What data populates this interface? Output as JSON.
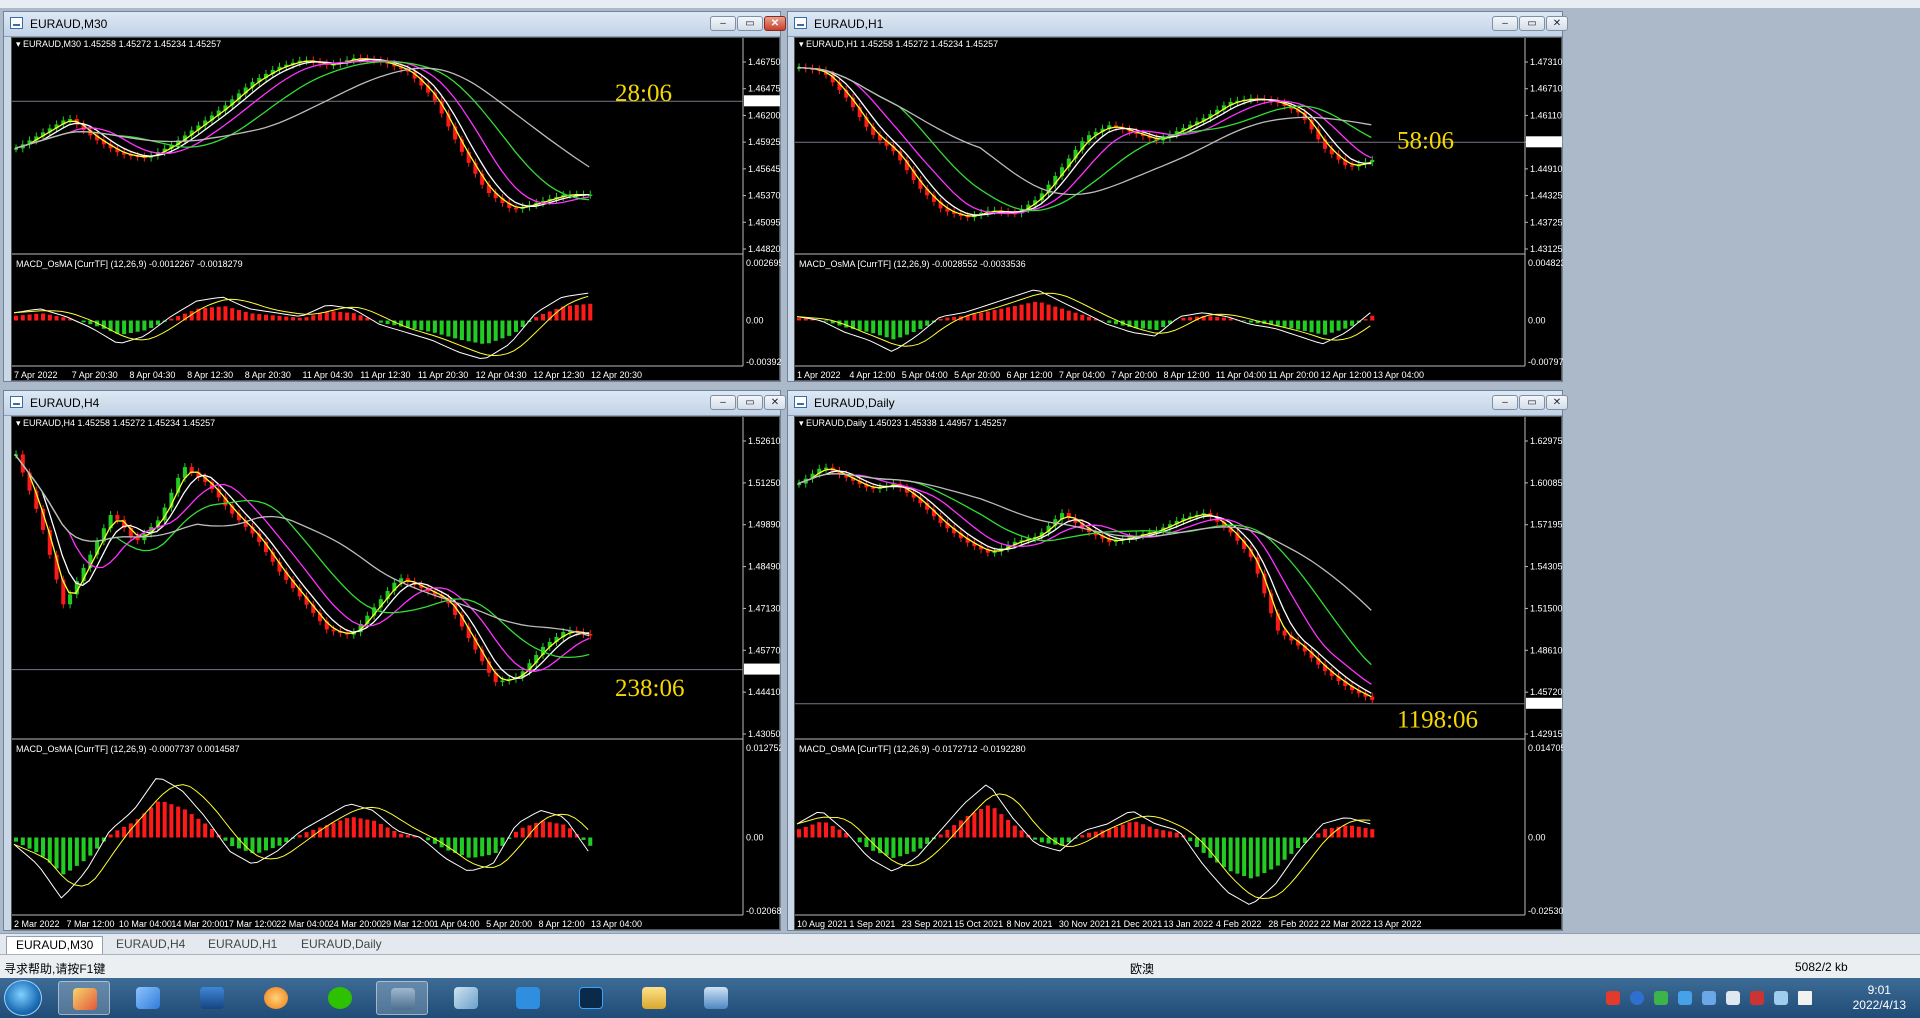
{
  "colors": {
    "bull": "#ff1a1a",
    "bear": "#22cc22",
    "timer": "#f5d800",
    "ma_fast": "#ffff33",
    "ma_white": "#ffffff",
    "ma_magenta": "#ff33ff",
    "ma_green": "#33dd33",
    "ma_gray": "#bbbbbb"
  },
  "windows": [
    {
      "title": "EURAUD,M30",
      "header": "EURAUD,M30  1.45258 1.45272 1.45234 1.45257",
      "timer": "28:06",
      "price_ticks": [
        "1.46750",
        "1.46475",
        "1.46200",
        "1.45925",
        "1.45645",
        "1.45370",
        "1.45095",
        "1.44820"
      ],
      "current_price": "1.45257",
      "macd_label": "MACD_OsMA [CurrTF] (12,26,9) -0.0012267 -0.0018279",
      "macd_ticks": [
        "0.0026953",
        "0.00",
        "-0.003926"
      ],
      "time_ticks": [
        "7 Apr 2022",
        "7 Apr 20:30",
        "8 Apr 04:30",
        "8 Apr 12:30",
        "8 Apr 20:30",
        "11 Apr 04:30",
        "11 Apr 12:30",
        "11 Apr 20:30",
        "12 Apr 04:30",
        "12 Apr 12:30",
        "12 Apr 20:30"
      ],
      "series": [
        50,
        58,
        66,
        55,
        47,
        45,
        52,
        62,
        72,
        84,
        92,
        96,
        93,
        97,
        95,
        90,
        76,
        50,
        28,
        18,
        22,
        26,
        26
      ],
      "price_level": 0.26,
      "timer_level": 0.22,
      "macd": [
        0.2,
        0.3,
        0.1,
        -0.2,
        -0.6,
        -0.4,
        0.1,
        0.5,
        0.6,
        0.3,
        0.2,
        0.1,
        0.4,
        0.3,
        -0.1,
        -0.3,
        -0.5,
        -0.8,
        -1.0,
        -0.6,
        0.2,
        0.6,
        0.7
      ]
    },
    {
      "title": "EURAUD,H1",
      "header": "EURAUD,H1  1.45258 1.45272 1.45234 1.45257",
      "timer": "58:06",
      "price_ticks": [
        "1.47310",
        "1.46710",
        "1.46110",
        "1.45510",
        "1.44910",
        "1.44325",
        "1.43725",
        "1.43125"
      ],
      "current_price": "1.45257",
      "macd_label": "MACD_OsMA [CurrTF] (12,26,9) -0.0028552 -0.0033536",
      "macd_ticks": [
        "0.004823",
        "0.00",
        "-0.007970"
      ],
      "time_ticks": [
        "1 Apr 2022",
        "4 Apr 12:00",
        "5 Apr 04:00",
        "5 Apr 20:00",
        "6 Apr 12:00",
        "7 Apr 04:00",
        "7 Apr 20:00",
        "8 Apr 12:00",
        "11 Apr 04:00",
        "11 Apr 20:00",
        "12 Apr 12:00",
        "13 Apr 04:00"
      ],
      "series": [
        92,
        90,
        76,
        58,
        48,
        30,
        18,
        14,
        18,
        16,
        24,
        40,
        56,
        62,
        58,
        54,
        60,
        66,
        74,
        76,
        74,
        68,
        50,
        40,
        44
      ],
      "price_level": 0.46,
      "timer_level": 0.45,
      "macd": [
        0.1,
        0.0,
        -0.3,
        -0.5,
        -0.8,
        -0.4,
        0.1,
        0.2,
        0.4,
        0.6,
        0.8,
        0.5,
        0.2,
        -0.1,
        -0.3,
        -0.4,
        0.1,
        0.2,
        0.1,
        -0.1,
        -0.2,
        -0.4,
        -0.6,
        -0.3,
        0.2
      ]
    },
    {
      "title": "EURAUD,H4",
      "header": "EURAUD,H4  1.45258 1.45272 1.45234 1.45257",
      "timer": "238:06",
      "price_ticks": [
        "1.52610",
        "1.51250",
        "1.49890",
        "1.48490",
        "1.47130",
        "1.45770",
        "1.44410",
        "1.43050"
      ],
      "current_price": "1.45257",
      "macd_label": "MACD_OsMA [CurrTF] (12,26,9) -0.0007737 0.0014587",
      "macd_ticks": [
        "0.012752",
        "0.00",
        "-0.020687"
      ],
      "time_ticks": [
        "2 Mar 2022",
        "7 Mar 12:00",
        "10 Mar 04:00",
        "14 Mar 20:00",
        "17 Mar 12:00",
        "22 Mar 04:00",
        "24 Mar 20:00",
        "29 Mar 12:00",
        "1 Apr 04:00",
        "5 Apr 20:00",
        "8 Apr 12:00",
        "13 Apr 04:00"
      ],
      "series": [
        92,
        70,
        40,
        56,
        72,
        62,
        70,
        88,
        82,
        72,
        64,
        52,
        42,
        32,
        30,
        40,
        50,
        46,
        42,
        28,
        14,
        16,
        26,
        32,
        30
      ],
      "price_level": 0.78,
      "timer_level": 0.84,
      "macd": [
        -0.1,
        -0.4,
        -0.9,
        -0.5,
        0.1,
        0.4,
        0.9,
        0.7,
        0.3,
        -0.2,
        -0.4,
        -0.2,
        0.1,
        0.3,
        0.5,
        0.4,
        0.1,
        0.0,
        -0.3,
        -0.5,
        -0.4,
        0.2,
        0.4,
        0.3,
        -0.2
      ]
    },
    {
      "title": "EURAUD,Daily",
      "header": "EURAUD,Daily  1.45023 1.45338 1.44957 1.45257",
      "timer": "1198:06",
      "price_ticks": [
        "1.62975",
        "1.60085",
        "1.57195",
        "1.54305",
        "1.51500",
        "1.48610",
        "1.45720",
        "1.42915"
      ],
      "current_price": "1.45257",
      "macd_label": "MACD_OsMA [CurrTF] (12,26,9) -0.0172712 -0.0192280",
      "macd_ticks": [
        "0.0147054",
        "0.00",
        "-0.025307"
      ],
      "time_ticks": [
        "10 Aug 2021",
        "1 Sep 2021",
        "23 Sep 2021",
        "15 Oct 2021",
        "8 Nov 2021",
        "30 Nov 2021",
        "21 Dec 2021",
        "13 Jan 2022",
        "4 Feb 2022",
        "28 Feb 2022",
        "22 Mar 2022",
        "13 Apr 2022"
      ],
      "series": [
        82,
        88,
        84,
        80,
        82,
        76,
        68,
        62,
        58,
        62,
        64,
        72,
        66,
        62,
        64,
        66,
        70,
        72,
        66,
        56,
        32,
        26,
        18,
        12,
        8
      ],
      "price_level": 0.89,
      "timer_level": 0.94,
      "macd": [
        0.2,
        0.4,
        0.1,
        -0.3,
        -0.5,
        -0.3,
        0.1,
        0.5,
        0.8,
        0.3,
        -0.1,
        -0.2,
        0.1,
        0.2,
        0.4,
        0.2,
        0.1,
        -0.4,
        -0.8,
        -1.0,
        -0.7,
        -0.2,
        0.2,
        0.3,
        0.2
      ]
    }
  ],
  "tabs": [
    "EURAUD,M30",
    "EURAUD,H4",
    "EURAUD,H1",
    "EURAUD,Daily"
  ],
  "status": {
    "help": "寻求帮助,请按F1键",
    "profile": "欧澳",
    "traffic": "5082/2 kb"
  },
  "taskbar": {
    "time": "9:01",
    "date": "2022/4/13"
  }
}
